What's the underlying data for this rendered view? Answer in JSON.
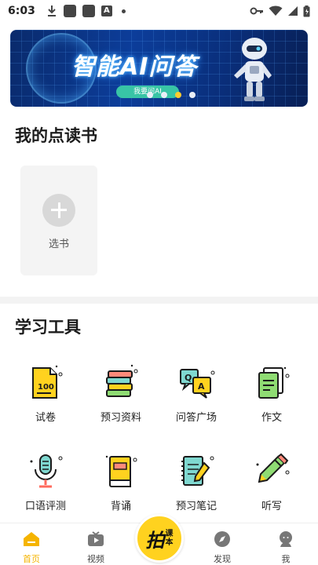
{
  "status_bar": {
    "time": "6:03",
    "app_icon_letter": "A"
  },
  "banner": {
    "title": "智能AI问答",
    "button_label": "我要问AI",
    "dots": 4,
    "active_dot": 2
  },
  "books": {
    "title": "我的点读书",
    "add_label": "选书"
  },
  "tools": {
    "title": "学习工具",
    "items": [
      {
        "label": "试卷",
        "icon": "exam-paper-icon"
      },
      {
        "label": "预习资料",
        "icon": "books-stack-icon"
      },
      {
        "label": "问答广场",
        "icon": "qa-bubbles-icon"
      },
      {
        "label": "作文",
        "icon": "essay-icon"
      },
      {
        "label": "口语评测",
        "icon": "microphone-icon"
      },
      {
        "label": "背诵",
        "icon": "recite-book-icon"
      },
      {
        "label": "预习笔记",
        "icon": "notebook-pencil-icon"
      },
      {
        "label": "听写",
        "icon": "pencil-icon"
      }
    ]
  },
  "bottom_nav": {
    "home": "首页",
    "video": "视频",
    "center_big": "拍",
    "center_small_1": "课",
    "center_small_2": "本",
    "discover": "发现",
    "me": "我"
  },
  "colors": {
    "accent": "#ffd21f",
    "active_nav": "#f5b400",
    "banner_bg": "#0c3d9a"
  }
}
